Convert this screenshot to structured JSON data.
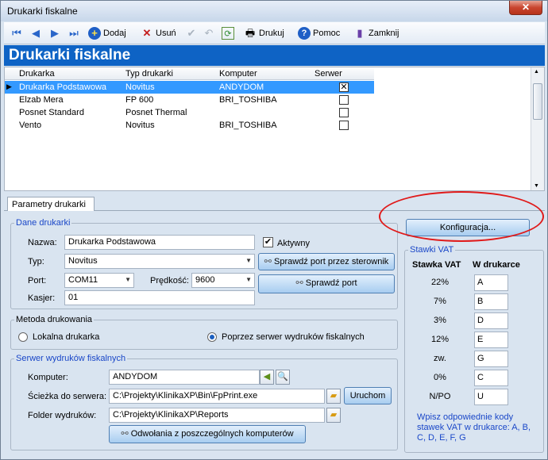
{
  "window": {
    "title": "Drukarki fiskalne",
    "close": "✕"
  },
  "toolbar": {
    "add_label": "Dodaj",
    "delete_label": "Usuń",
    "print_label": "Drukuj",
    "help_label": "Pomoc",
    "close_label": "Zamknij"
  },
  "header": {
    "title": "Drukarki fiskalne"
  },
  "grid": {
    "columns": [
      "Drukarka",
      "Typ drukarki",
      "Komputer",
      "Serwer"
    ],
    "rows": [
      {
        "name": "Drukarka Podstawowa",
        "type": "Novitus",
        "computer": "ANDYDOM",
        "server": true,
        "selected": true
      },
      {
        "name": "Elzab Mera",
        "type": "FP 600",
        "computer": "BRI_TOSHIBA",
        "server": false,
        "selected": false
      },
      {
        "name": "Posnet Standard",
        "type": "Posnet Thermal",
        "computer": "",
        "server": false,
        "selected": false
      },
      {
        "name": "Vento",
        "type": "Novitus",
        "computer": "BRI_TOSHIBA",
        "server": false,
        "selected": false
      }
    ]
  },
  "tabs": {
    "params": "Parametry drukarki"
  },
  "printer_data": {
    "legend": "Dane drukarki",
    "name_label": "Nazwa:",
    "name_value": "Drukarka Podstawowa",
    "active_label": "Aktywny",
    "active_checked": true,
    "type_label": "Typ:",
    "type_value": "Novitus",
    "port_label": "Port:",
    "port_value": "COM11",
    "speed_label": "Prędkość:",
    "speed_value": "9600",
    "cashier_label": "Kasjer:",
    "cashier_value": "01",
    "check_port_driver": "Sprawdź port przez sterownik",
    "check_port": "Sprawdź port"
  },
  "print_method": {
    "legend": "Metoda drukowania",
    "local": "Lokalna drukarka",
    "server": "Poprzez serwer wydruków fiskalnych",
    "selected": "server"
  },
  "print_server": {
    "legend": "Serwer wydruków fiskalnych",
    "computer_label": "Komputer:",
    "computer_value": "ANDYDOM",
    "path_label": "Ścieżka do serwera:",
    "path_value": "C:\\Projekty\\KlinikaXP\\Bin\\FpPrint.exe",
    "run_button": "Uruchom",
    "folder_label": "Folder wydruków:",
    "folder_value": "C:\\Projekty\\KlinikaXP\\Reports",
    "refs_button": "Odwołania z poszczególnych komputerów"
  },
  "config": {
    "button": "Konfiguracja..."
  },
  "vat": {
    "legend": "Stawki VAT",
    "col_rate": "Stawka VAT",
    "col_printer": "W drukarce",
    "rows": [
      {
        "rate": "22%",
        "code": "A"
      },
      {
        "rate": "7%",
        "code": "B"
      },
      {
        "rate": "3%",
        "code": "D"
      },
      {
        "rate": "12%",
        "code": "E"
      },
      {
        "rate": "zw.",
        "code": "G"
      },
      {
        "rate": "0%",
        "code": "C"
      },
      {
        "rate": "N/PO",
        "code": "U"
      }
    ],
    "hint": "Wpisz odpowiednie kody stawek VAT w drukarce: A, B, C, D, E, F, G"
  },
  "colors": {
    "header_bg": "#0e63c5",
    "selection": "#3399ff",
    "highlight": "#e01a1a"
  }
}
